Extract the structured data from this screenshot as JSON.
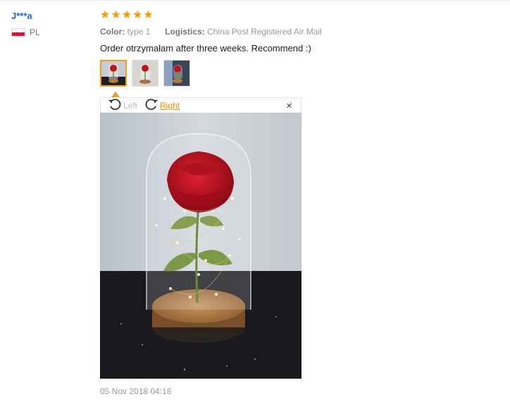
{
  "reviewer": {
    "name": "J***a",
    "country": "PL",
    "flag_icon": "poland-flag-icon"
  },
  "rating": {
    "stars": 5,
    "max": 5,
    "display": "★★★★★",
    "color": "#ff9900"
  },
  "attributes": {
    "color_label": "Color:",
    "color_value": "type 1",
    "logistics_label": "Logistics:",
    "logistics_value": "China Post Registered Air Mail"
  },
  "review_text": "Order otrzymałam after three weeks. Recommend :)",
  "photos": [
    {
      "name": "photo-thumbnail-1",
      "selected": true
    },
    {
      "name": "photo-thumbnail-2",
      "selected": false
    },
    {
      "name": "photo-thumbnail-3",
      "selected": false
    }
  ],
  "viewer": {
    "rotate_left_label": "Left",
    "rotate_right_label": "Right",
    "close_symbol": "×"
  },
  "date": "05 Nov 2018 04:16",
  "colors": {
    "username": "#2166c8",
    "accent": "#f0a020",
    "link_orange": "#f08c00"
  }
}
